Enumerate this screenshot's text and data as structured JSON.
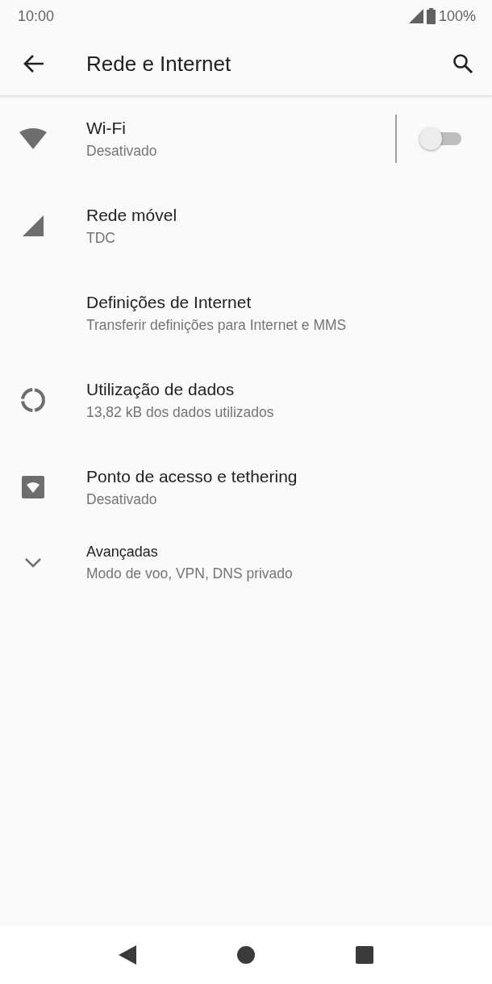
{
  "status_bar": {
    "time": "10:00",
    "battery": "100%"
  },
  "app_bar": {
    "title": "Rede e Internet"
  },
  "items": [
    {
      "kind": "wifi",
      "title": "Wi-Fi",
      "subtitle": "Desativado",
      "on": false
    },
    {
      "kind": "mobile",
      "title": "Rede móvel",
      "subtitle": "TDC"
    },
    {
      "kind": "plain",
      "title": "Definições de Internet",
      "subtitle": "Transferir definições para Internet e MMS"
    },
    {
      "kind": "data",
      "title": "Utilização de dados",
      "subtitle": "13,82 kB dos dados utilizados"
    },
    {
      "kind": "hotspot",
      "title": "Ponto de acesso e tethering",
      "subtitle": "Desativado"
    },
    {
      "kind": "advanced",
      "title": "Avançadas",
      "subtitle": "Modo de voo, VPN, DNS privado",
      "expanded": false
    }
  ]
}
